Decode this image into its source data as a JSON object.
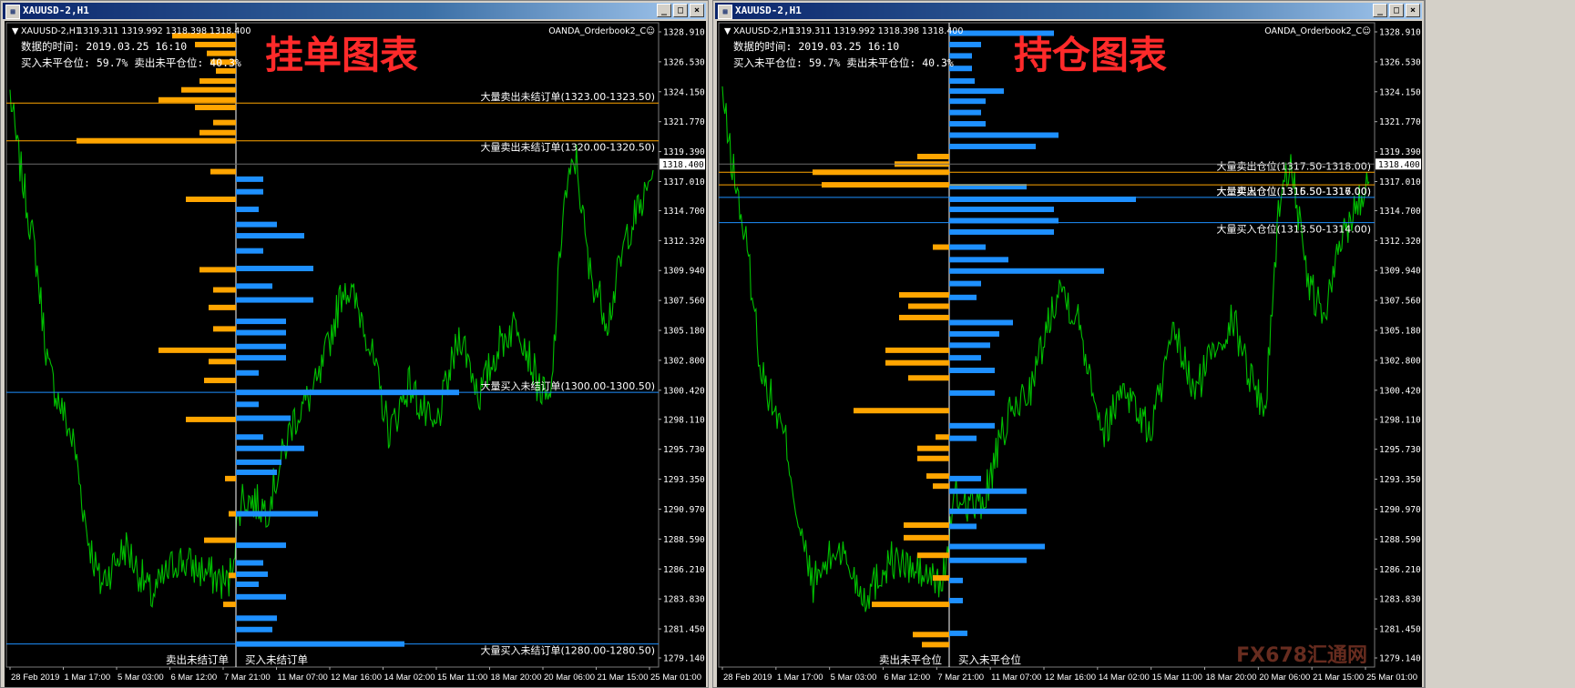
{
  "colors": {
    "background": "#000000",
    "candle": "#00c000",
    "sell": "#ffa500",
    "buy": "#1e90ff",
    "price_box": "#ffffff",
    "axis_text": "#ffffff",
    "overlay_title": "#ff2a2a"
  },
  "windows": [
    {
      "title": "XAUUSD-2,H1",
      "buttons": [
        "_",
        "□",
        "×"
      ],
      "header_symbol": "XAUUSD-2,H1",
      "header_prices": "1319.311 1319.992 1318.398 1318.400",
      "indicator_name": "OANDA_Orderbook2_C☺",
      "info_time": "数据的时间: 2019.03.25 16:10",
      "info_ratio": "买入未平仓位: 59.7%  卖出未平仓位: 40.3%",
      "overlay_title": "挂单图表",
      "current_price": "1318.400",
      "price_ticks": [
        "1328.910",
        "1326.530",
        "1324.150",
        "1321.770",
        "1319.390",
        "1317.010",
        "1314.700",
        "1312.320",
        "1309.940",
        "1307.560",
        "1305.180",
        "1302.800",
        "1300.420",
        "1298.110",
        "1295.730",
        "1293.350",
        "1290.970",
        "1288.590",
        "1286.210",
        "1283.830",
        "1281.450",
        "1279.140"
      ],
      "date_ticks": [
        "28 Feb 2019",
        "1 Mar 17:00",
        "5 Mar 03:00",
        "6 Mar 12:00",
        "7 Mar 21:00",
        "11 Mar 07:00",
        "12 Mar 16:00",
        "14 Mar 02:00",
        "15 Mar 11:00",
        "18 Mar 20:00",
        "20 Mar 06:00",
        "21 Mar 15:00",
        "25 Mar 01:00"
      ],
      "level_lines": [
        {
          "label": "大量卖出未结订单(1323.00-1323.50)",
          "price": 1323.25,
          "color": "#ffa500"
        },
        {
          "label": "大量卖出未结订单(1320.00-1320.50)",
          "price": 1320.25,
          "color": "#ffa500"
        },
        {
          "label": "大量买入未结订单(1300.00-1300.50)",
          "price": 1300.25,
          "color": "#1e90ff"
        },
        {
          "label": "大量买入未结订单(1280.00-1280.50)",
          "price": 1280.25,
          "color": "#1e90ff"
        }
      ],
      "bottom_sell_label": "卖出未结订单",
      "bottom_buy_label": "买入未结订单",
      "sell": [
        {
          "p": 1328.6,
          "v": 70
        },
        {
          "p": 1327.9,
          "v": 45
        },
        {
          "p": 1327.2,
          "v": 32
        },
        {
          "p": 1326.5,
          "v": 28
        },
        {
          "p": 1325.8,
          "v": 22
        },
        {
          "p": 1325.0,
          "v": 40
        },
        {
          "p": 1324.3,
          "v": 60
        },
        {
          "p": 1323.5,
          "v": 85
        },
        {
          "p": 1322.9,
          "v": 45
        },
        {
          "p": 1321.7,
          "v": 25
        },
        {
          "p": 1320.9,
          "v": 40
        },
        {
          "p": 1320.25,
          "v": 175
        },
        {
          "p": 1317.8,
          "v": 28
        },
        {
          "p": 1315.6,
          "v": 55
        },
        {
          "p": 1310.0,
          "v": 40
        },
        {
          "p": 1308.4,
          "v": 25
        },
        {
          "p": 1307.0,
          "v": 30
        },
        {
          "p": 1305.3,
          "v": 25
        },
        {
          "p": 1303.6,
          "v": 85
        },
        {
          "p": 1302.7,
          "v": 30
        },
        {
          "p": 1301.2,
          "v": 35
        },
        {
          "p": 1298.1,
          "v": 55
        },
        {
          "p": 1293.4,
          "v": 12
        },
        {
          "p": 1290.6,
          "v": 8
        },
        {
          "p": 1288.5,
          "v": 35
        },
        {
          "p": 1285.7,
          "v": 8
        },
        {
          "p": 1283.4,
          "v": 14
        }
      ],
      "buy": [
        {
          "p": 1317.2,
          "v": 30
        },
        {
          "p": 1316.2,
          "v": 30
        },
        {
          "p": 1314.8,
          "v": 25
        },
        {
          "p": 1313.6,
          "v": 45
        },
        {
          "p": 1312.7,
          "v": 75
        },
        {
          "p": 1311.5,
          "v": 30
        },
        {
          "p": 1310.1,
          "v": 85
        },
        {
          "p": 1308.7,
          "v": 40
        },
        {
          "p": 1307.6,
          "v": 85
        },
        {
          "p": 1305.9,
          "v": 55
        },
        {
          "p": 1305.0,
          "v": 55
        },
        {
          "p": 1303.9,
          "v": 55
        },
        {
          "p": 1303.0,
          "v": 55
        },
        {
          "p": 1301.8,
          "v": 25
        },
        {
          "p": 1300.25,
          "v": 245
        },
        {
          "p": 1299.3,
          "v": 25
        },
        {
          "p": 1298.2,
          "v": 60
        },
        {
          "p": 1296.7,
          "v": 30
        },
        {
          "p": 1295.8,
          "v": 75
        },
        {
          "p": 1294.7,
          "v": 50
        },
        {
          "p": 1293.9,
          "v": 45
        },
        {
          "p": 1290.6,
          "v": 90
        },
        {
          "p": 1288.1,
          "v": 55
        },
        {
          "p": 1286.7,
          "v": 30
        },
        {
          "p": 1285.8,
          "v": 35
        },
        {
          "p": 1285.0,
          "v": 25
        },
        {
          "p": 1284.0,
          "v": 55
        },
        {
          "p": 1282.3,
          "v": 45
        },
        {
          "p": 1281.4,
          "v": 40
        },
        {
          "p": 1280.25,
          "v": 185
        }
      ]
    },
    {
      "title": "XAUUSD-2,H1",
      "buttons": [
        "_",
        "□",
        "×"
      ],
      "header_symbol": "XAUUSD-2,H1",
      "header_prices": "1319.311 1319.992 1318.398 1318.400",
      "indicator_name": "OANDA_Orderbook2_C☺",
      "info_time": "数据的时间: 2019.03.25 16:10",
      "info_ratio": "买入未平仓位: 59.7%  卖出未平仓位: 40.3%",
      "overlay_title": "持仓图表",
      "current_price": "1318.400",
      "price_ticks": [
        "1328.910",
        "1326.530",
        "1324.150",
        "1321.770",
        "1319.390",
        "1317.010",
        "1314.700",
        "1312.320",
        "1309.940",
        "1307.560",
        "1305.180",
        "1302.800",
        "1300.420",
        "1298.110",
        "1295.730",
        "1293.350",
        "1290.970",
        "1288.590",
        "1286.210",
        "1283.830",
        "1281.450",
        "1279.140"
      ],
      "date_ticks": [
        "28 Feb 2019",
        "1 Mar 17:00",
        "5 Mar 03:00",
        "6 Mar 12:00",
        "7 Mar 21:00",
        "11 Mar 07:00",
        "12 Mar 16:00",
        "14 Mar 02:00",
        "15 Mar 11:00",
        "18 Mar 20:00",
        "20 Mar 06:00",
        "21 Mar 15:00",
        "25 Mar 01:00"
      ],
      "level_lines": [
        {
          "label": "大量卖出仓位(1317.50-1318.00)",
          "price": 1317.75,
          "color": "#ffa500"
        },
        {
          "label": "大量卖出仓位(1316.50-1317.00)",
          "price": 1316.75,
          "color": "#ffa500"
        },
        {
          "label": "大量买入仓位(1315.50-1316.00)",
          "price": 1315.75,
          "color": "#1e90ff"
        },
        {
          "label": "大量买入仓位(1313.50-1314.00)",
          "price": 1313.75,
          "color": "#1e90ff"
        }
      ],
      "bottom_sell_label": "卖出未平仓位",
      "bottom_buy_label": "买入未平仓位",
      "sell": [
        {
          "p": 1319.0,
          "v": 35
        },
        {
          "p": 1318.4,
          "v": 60
        },
        {
          "p": 1317.75,
          "v": 150
        },
        {
          "p": 1316.75,
          "v": 140
        },
        {
          "p": 1311.8,
          "v": 18
        },
        {
          "p": 1308.0,
          "v": 55
        },
        {
          "p": 1307.1,
          "v": 45
        },
        {
          "p": 1306.2,
          "v": 55
        },
        {
          "p": 1303.6,
          "v": 70
        },
        {
          "p": 1302.6,
          "v": 70
        },
        {
          "p": 1301.4,
          "v": 45
        },
        {
          "p": 1298.8,
          "v": 105
        },
        {
          "p": 1296.7,
          "v": 15
        },
        {
          "p": 1295.8,
          "v": 35
        },
        {
          "p": 1295.0,
          "v": 35
        },
        {
          "p": 1293.6,
          "v": 25
        },
        {
          "p": 1292.8,
          "v": 18
        },
        {
          "p": 1289.7,
          "v": 50
        },
        {
          "p": 1288.7,
          "v": 50
        },
        {
          "p": 1287.3,
          "v": 35
        },
        {
          "p": 1285.5,
          "v": 18
        },
        {
          "p": 1283.4,
          "v": 85
        },
        {
          "p": 1281.0,
          "v": 40
        },
        {
          "p": 1280.2,
          "v": 30
        }
      ],
      "buy": [
        {
          "p": 1328.8,
          "v": 115
        },
        {
          "p": 1327.9,
          "v": 35
        },
        {
          "p": 1327.0,
          "v": 25
        },
        {
          "p": 1326.0,
          "v": 25
        },
        {
          "p": 1325.0,
          "v": 28
        },
        {
          "p": 1324.2,
          "v": 60
        },
        {
          "p": 1323.4,
          "v": 40
        },
        {
          "p": 1322.5,
          "v": 35
        },
        {
          "p": 1321.6,
          "v": 40
        },
        {
          "p": 1320.7,
          "v": 120
        },
        {
          "p": 1319.8,
          "v": 95
        },
        {
          "p": 1316.6,
          "v": 85
        },
        {
          "p": 1315.6,
          "v": 205
        },
        {
          "p": 1314.8,
          "v": 115
        },
        {
          "p": 1313.9,
          "v": 120
        },
        {
          "p": 1313.0,
          "v": 115
        },
        {
          "p": 1311.8,
          "v": 40
        },
        {
          "p": 1310.8,
          "v": 65
        },
        {
          "p": 1309.9,
          "v": 170
        },
        {
          "p": 1308.9,
          "v": 35
        },
        {
          "p": 1307.8,
          "v": 30
        },
        {
          "p": 1305.8,
          "v": 70
        },
        {
          "p": 1304.9,
          "v": 55
        },
        {
          "p": 1304.0,
          "v": 45
        },
        {
          "p": 1303.0,
          "v": 35
        },
        {
          "p": 1302.0,
          "v": 50
        },
        {
          "p": 1300.2,
          "v": 50
        },
        {
          "p": 1297.6,
          "v": 50
        },
        {
          "p": 1296.6,
          "v": 30
        },
        {
          "p": 1293.4,
          "v": 35
        },
        {
          "p": 1292.4,
          "v": 85
        },
        {
          "p": 1290.8,
          "v": 85
        },
        {
          "p": 1289.6,
          "v": 30
        },
        {
          "p": 1288.0,
          "v": 105
        },
        {
          "p": 1286.9,
          "v": 85
        },
        {
          "p": 1285.3,
          "v": 15
        },
        {
          "p": 1283.7,
          "v": 15
        },
        {
          "p": 1281.1,
          "v": 20
        }
      ]
    }
  ],
  "watermark": "FX678汇通网"
}
